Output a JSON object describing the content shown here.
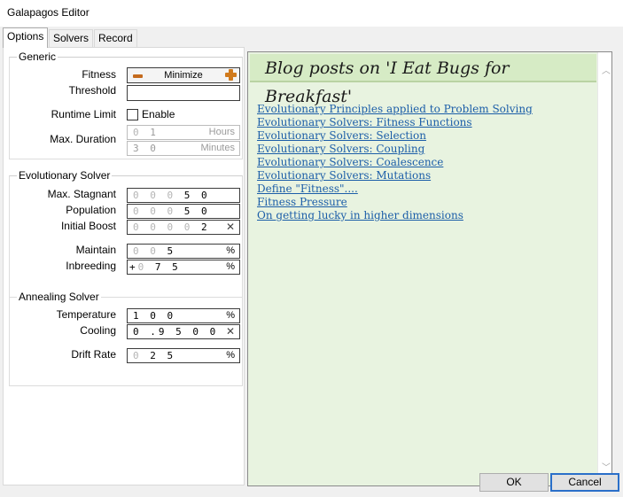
{
  "window": {
    "title": "Galapagos Editor"
  },
  "tabs": [
    {
      "label": "Options"
    },
    {
      "label": "Solvers"
    },
    {
      "label": "Record"
    }
  ],
  "generic": {
    "title": "Generic",
    "fitness_label": "Fitness",
    "fitness_value": "Minimize",
    "threshold_label": "Threshold",
    "threshold_value": "",
    "runtime_label": "Runtime Limit",
    "runtime_enable_label": "Enable",
    "runtime_enabled": false,
    "hours_dim": "0",
    "hours_value": "1",
    "hours_unit": "Hours",
    "duration_label": "Max. Duration",
    "minutes_value": "3 0",
    "minutes_unit": "Minutes"
  },
  "evolutionary": {
    "title": "Evolutionary Solver",
    "stagnant_label": "Max. Stagnant",
    "stagnant_dim": "0 0 0",
    "stagnant_value": "5 0",
    "population_label": "Population",
    "population_dim": "0 0 0",
    "population_value": "5 0",
    "boost_label": "Initial Boost",
    "boost_dim": "0 0 0 0",
    "boost_value": "2",
    "boost_clear": "✕",
    "maintain_label": "Maintain",
    "maintain_dim": "0 0",
    "maintain_value": "5",
    "maintain_unit": "%",
    "inbreeding_label": "Inbreeding",
    "inbreeding_sign": "+",
    "inbreeding_dim": "0",
    "inbreeding_value": "7 5",
    "inbreeding_unit": "%"
  },
  "annealing": {
    "title": "Annealing Solver",
    "temperature_label": "Temperature",
    "temperature_value": "1 0 0",
    "temperature_unit": "%",
    "cooling_label": "Cooling",
    "cooling_value": "0 .9 5 0 0",
    "cooling_clear": "✕",
    "drift_label": "Drift Rate",
    "drift_dim": "0",
    "drift_value": "2 5",
    "drift_unit": "%"
  },
  "blog": {
    "title": "Blog posts on 'I Eat Bugs for Breakfast'",
    "links": [
      "Evolutionary Principles applied to Problem Solving",
      "Evolutionary Solvers: Fitness Functions",
      "Evolutionary Solvers: Selection",
      "Evolutionary Solvers: Coupling",
      "Evolutionary Solvers: Coalescence",
      "Evolutionary Solvers: Mutations",
      "Define \"Fitness\"....",
      "Fitness Pressure",
      "On getting lucky in higher dimensions"
    ]
  },
  "buttons": {
    "ok": "OK",
    "cancel": "Cancel"
  },
  "colors": {
    "accent": "#2a6fc9",
    "link": "#1c5ea8",
    "blog_bg": "#e8f3e0",
    "blog_header": "#d6ebc5"
  }
}
